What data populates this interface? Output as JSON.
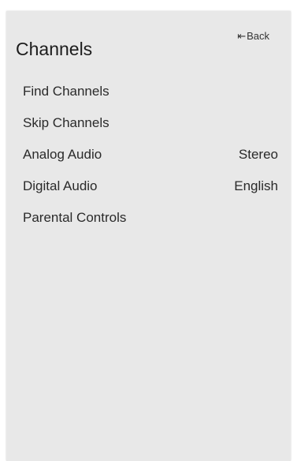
{
  "panel": {
    "title": "Channels",
    "back_label": "Back",
    "back_icon": "back-arrow-icon"
  },
  "menu": {
    "items": [
      {
        "label": "Find Channels",
        "value": ""
      },
      {
        "label": "Skip Channels",
        "value": ""
      },
      {
        "label": "Analog Audio",
        "value": "Stereo"
      },
      {
        "label": "Digital Audio",
        "value": "English"
      },
      {
        "label": "Parental Controls",
        "value": ""
      }
    ]
  }
}
